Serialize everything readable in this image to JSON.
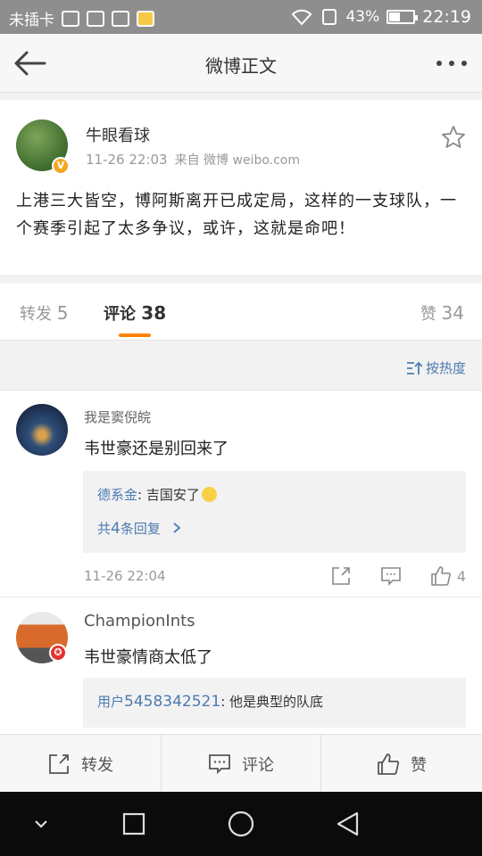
{
  "status_bar": {
    "carrier": "未插卡",
    "battery": "43%",
    "battery_level": 0.43,
    "time": "22:19"
  },
  "header": {
    "title": "微博正文",
    "back_icon": "back-arrow-icon",
    "more_icon": "more-dots-icon"
  },
  "post": {
    "author": "牛眼看球",
    "time": "11-26 22:03",
    "source": "来自 微博 weibo.com",
    "verified_badge": "V",
    "text": "上港三大皆空，博阿斯离开已成定局，这样的一支球队，一个赛季引起了太多争议，或许，这就是命吧！"
  },
  "tabs": {
    "repost_label": "转发",
    "repost_count": "5",
    "comment_label": "评论",
    "comment_count": "38",
    "like_label": "赞",
    "like_count": "34"
  },
  "sort": {
    "label": "按热度"
  },
  "comments": [
    {
      "user": "我是窦倪皖",
      "text": "韦世豪还是别回来了",
      "reply_user": "德系金",
      "reply_text": ": 吉国安了",
      "more_prefix": "共",
      "more_count": "4",
      "more_suffix": "条回复",
      "time": "11-26 22:04",
      "likes": "4"
    },
    {
      "user": "ChampionInts",
      "badge": "✪",
      "text": "韦世豪情商太低了",
      "reply_user_prefix": "用户",
      "reply_user_id": "5458342521",
      "reply_text": ": 他是典型的队底"
    }
  ],
  "toolbar": {
    "repost": "转发",
    "comment": "评论",
    "like": "赞"
  },
  "colors": {
    "accent": "#ff8200",
    "link": "#4c7bb0"
  }
}
